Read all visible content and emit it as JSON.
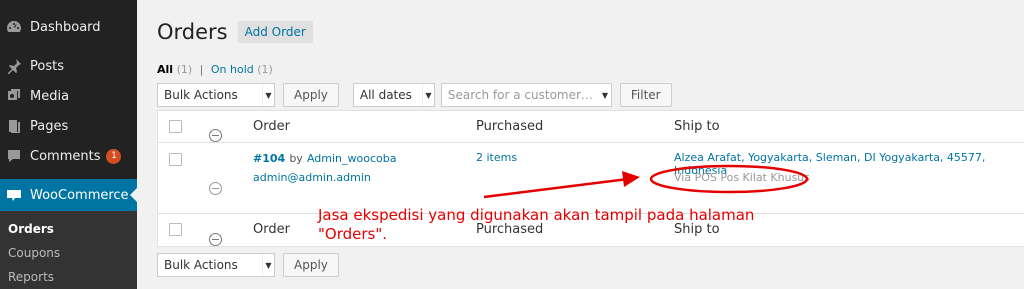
{
  "sidebar": {
    "items": [
      {
        "label": "Dashboard",
        "icon": "dashboard-icon"
      },
      {
        "label": "Posts",
        "icon": "pushpin-icon"
      },
      {
        "label": "Media",
        "icon": "media-icon"
      },
      {
        "label": "Pages",
        "icon": "pages-icon"
      },
      {
        "label": "Comments",
        "icon": "comments-icon",
        "badge": "1"
      }
    ],
    "active": {
      "label": "WooCommerce",
      "icon": "woocommerce-icon"
    },
    "submenu": [
      "Orders",
      "Coupons",
      "Reports"
    ]
  },
  "header": {
    "title": "Orders",
    "add_button": "Add Order"
  },
  "filters": {
    "all_label": "All",
    "all_count": "(1)",
    "separator": "|",
    "on_hold_label": "On hold",
    "on_hold_count": "(1)"
  },
  "tablenav_top": {
    "bulk_actions": "Bulk Actions",
    "apply": "Apply",
    "dates": "All dates",
    "search_placeholder": "Search for a customer…",
    "filter": "Filter"
  },
  "table": {
    "columns": [
      "Order",
      "Purchased",
      "Ship to"
    ],
    "rows": [
      {
        "order_number": "#104",
        "by_text": "by",
        "customer": "Admin_woocoba",
        "email": "admin@admin.admin",
        "purchased": "2 items",
        "ship_to": "Alzea Arafat, Yogyakarta, Sleman, DI Yogyakarta, 45577, Indonesia",
        "shipping_method": "Via POS Pos Kilat Khusus"
      }
    ]
  },
  "tablenav_bottom": {
    "bulk_actions": "Bulk Actions",
    "apply": "Apply"
  },
  "annotation": {
    "line1": "Jasa ekspedisi yang digunakan akan tampil pada halaman",
    "line2": "\"Orders\".",
    "color": "#e50000"
  },
  "colors": {
    "accent": "#0074a2",
    "sidebar": "#222222",
    "badge": "#d54e21"
  }
}
